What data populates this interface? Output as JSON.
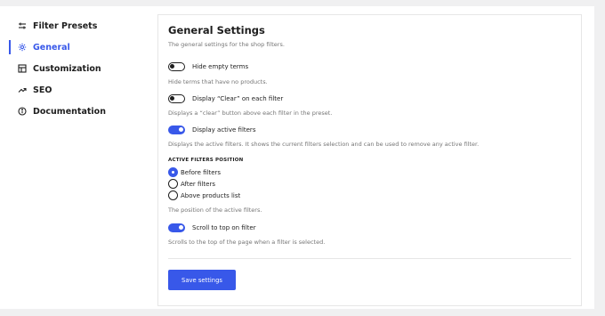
{
  "sidebar": {
    "items": [
      {
        "label": "Filter Presets",
        "icon": "sliders-icon"
      },
      {
        "label": "General",
        "icon": "gear-icon",
        "active": true
      },
      {
        "label": "Customization",
        "icon": "layout-icon"
      },
      {
        "label": "SEO",
        "icon": "trending-icon"
      },
      {
        "label": "Documentation",
        "icon": "info-icon"
      }
    ]
  },
  "main": {
    "title": "General Settings",
    "subtitle": "The general settings for the shop filters.",
    "options": [
      {
        "label": "Hide empty terms",
        "enabled": false,
        "help": "Hide terms that have no products."
      },
      {
        "label": "Display “Clear” on each filter",
        "enabled": false,
        "help": "Displays a “clear” button above each filter in the preset."
      },
      {
        "label": "Display active filters",
        "enabled": true,
        "help": "Displays the active filters. It shows the current filters selection and can be used to remove any active filter."
      }
    ],
    "active_filters_position": {
      "heading": "ACTIVE FILTERS POSITION",
      "choices": [
        "Before filters",
        "After filters",
        "Above products list"
      ],
      "selected": "Before filters",
      "help": "The position of the active filters."
    },
    "scroll_option": {
      "label": "Scroll to top on filter",
      "enabled": true,
      "help": "Scrolls to the top of the page when a filter is selected."
    },
    "save_label": "Save settings"
  },
  "colors": {
    "accent": "#3858e9",
    "muted_text": "#757575",
    "background": "#f0f0f1"
  }
}
